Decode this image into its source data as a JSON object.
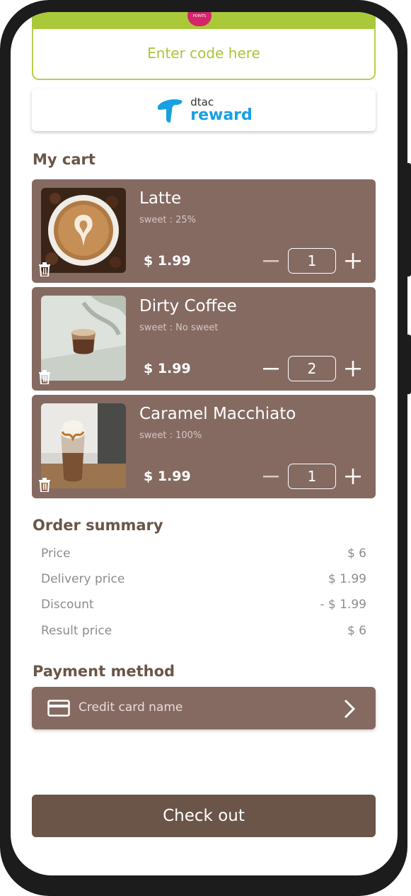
{
  "promo": {
    "badge": "POINTS",
    "code_placeholder": "Enter code here"
  },
  "reward": {
    "brand_top": "dtac",
    "brand_bottom": "reward"
  },
  "cart": {
    "title": "My cart",
    "items": [
      {
        "name": "Latte",
        "sweet": "sweet : 25%",
        "price": "$ 1.99",
        "qty": "1"
      },
      {
        "name": "Dirty Coffee",
        "sweet": "sweet : No sweet",
        "price": "$ 1.99",
        "qty": "2"
      },
      {
        "name": "Caramel Macchiato",
        "sweet": "sweet : 100%",
        "price": "$ 1.99",
        "qty": "1"
      }
    ]
  },
  "summary": {
    "title": "Order summary",
    "rows": [
      {
        "label": "Price",
        "value": "$ 6"
      },
      {
        "label": "Delivery price",
        "value": "$ 1.99"
      },
      {
        "label": "Discount",
        "value": "-  $ 1.99"
      },
      {
        "label": "Result price",
        "value": "$ 6"
      }
    ]
  },
  "payment": {
    "title": "Payment method",
    "card_label": "Credit card name"
  },
  "checkout": {
    "label": "Check out"
  },
  "colors": {
    "brown": "#856a62",
    "dark_brown": "#6b5548",
    "green": "#aac93a",
    "dtac_blue": "#19a0e0"
  }
}
